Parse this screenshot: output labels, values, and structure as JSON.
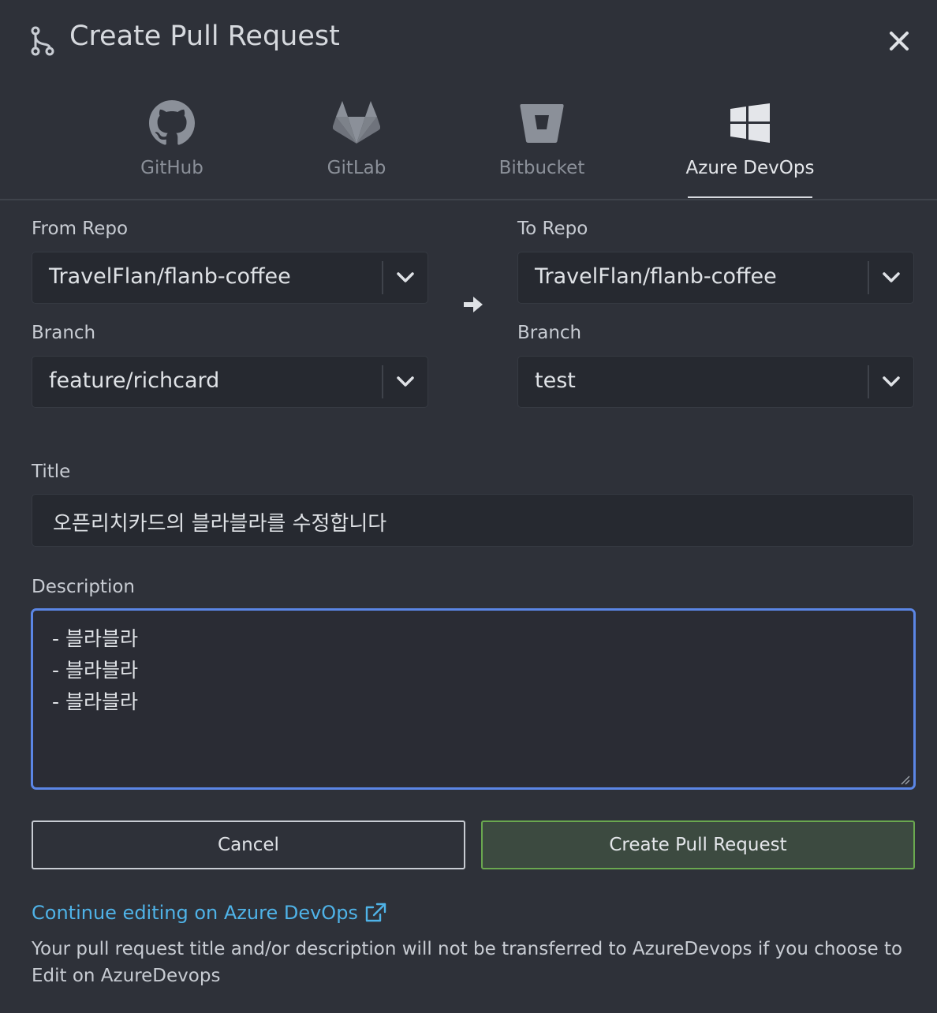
{
  "header": {
    "title": "Create Pull Request",
    "icon": "git-branch-icon"
  },
  "providers": [
    {
      "label": "GitHub",
      "icon": "github-icon",
      "active": false
    },
    {
      "label": "GitLab",
      "icon": "gitlab-icon",
      "active": false
    },
    {
      "label": "Bitbucket",
      "icon": "bitbucket-icon",
      "active": false
    },
    {
      "label": "Azure DevOps",
      "icon": "windows-icon",
      "active": true
    }
  ],
  "from": {
    "repo_label": "From Repo",
    "repo_value": "TravelFlan/flanb-coffee",
    "branch_label": "Branch",
    "branch_value": "feature/richcard"
  },
  "to": {
    "repo_label": "To Repo",
    "repo_value": "TravelFlan/flanb-coffee",
    "branch_label": "Branch",
    "branch_value": "test"
  },
  "form": {
    "title_label": "Title",
    "title_value": "오픈리치카드의 블라블라를 수정합니다",
    "description_label": "Description",
    "description_lines": [
      "- 블라블라",
      "- 블라블라",
      "- 블라블라"
    ]
  },
  "buttons": {
    "cancel": "Cancel",
    "create": "Create Pull Request"
  },
  "footer": {
    "link_text": "Continue editing on Azure DevOps",
    "note": "Your pull request title and/or description will not be transferred to AzureDevops if you choose to Edit on AzureDevops"
  },
  "colors": {
    "background": "#2e3139",
    "field": "#262930",
    "focus_border": "#5b86e5",
    "create_border": "#6aa84f",
    "link": "#4fb3e8"
  }
}
